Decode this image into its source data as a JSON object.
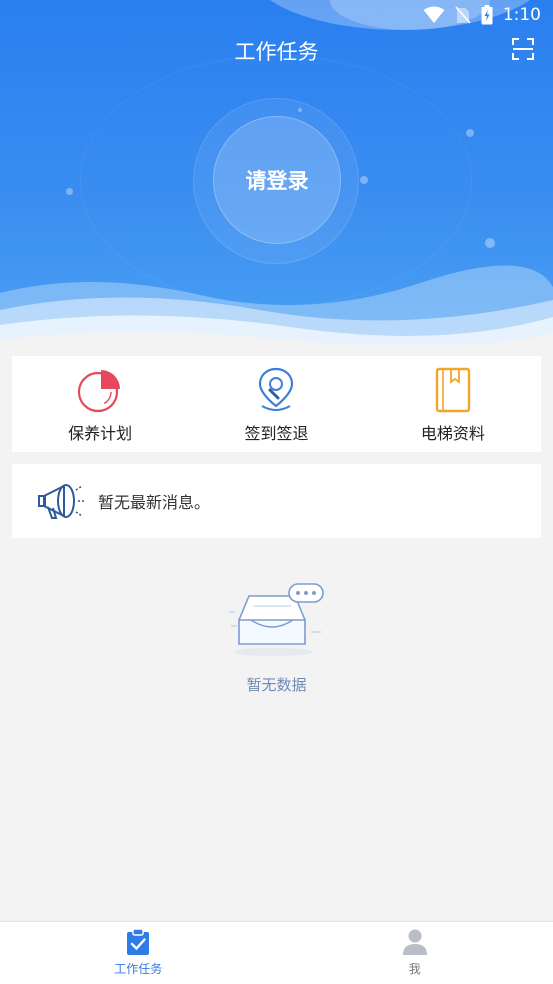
{
  "status_bar": {
    "time": "1:10",
    "icons": [
      "wifi-icon",
      "no-sim-icon",
      "battery-charging-icon"
    ]
  },
  "header": {
    "title": "工作任务",
    "scan_icon": "scan-icon"
  },
  "login": {
    "label": "请登录"
  },
  "menu": [
    {
      "label": "保养计划",
      "icon": "pie-chart-icon",
      "color": "#e8485e"
    },
    {
      "label": "签到签退",
      "icon": "location-pin-icon",
      "color": "#3b7fd9"
    },
    {
      "label": "电梯资料",
      "icon": "book-icon",
      "color": "#f0a62b"
    }
  ],
  "notice": {
    "text": "暂无最新消息。",
    "icon": "megaphone-icon"
  },
  "empty": {
    "text": "暂无数据",
    "icon": "empty-box-icon"
  },
  "tabbar": [
    {
      "label": "工作任务",
      "icon": "clipboard-check-icon",
      "active": true
    },
    {
      "label": "我",
      "icon": "user-icon",
      "active": false
    }
  ],
  "colors": {
    "primary": "#2f7be8",
    "header_top": "#2a7ff0",
    "background": "#f3f3f3"
  }
}
